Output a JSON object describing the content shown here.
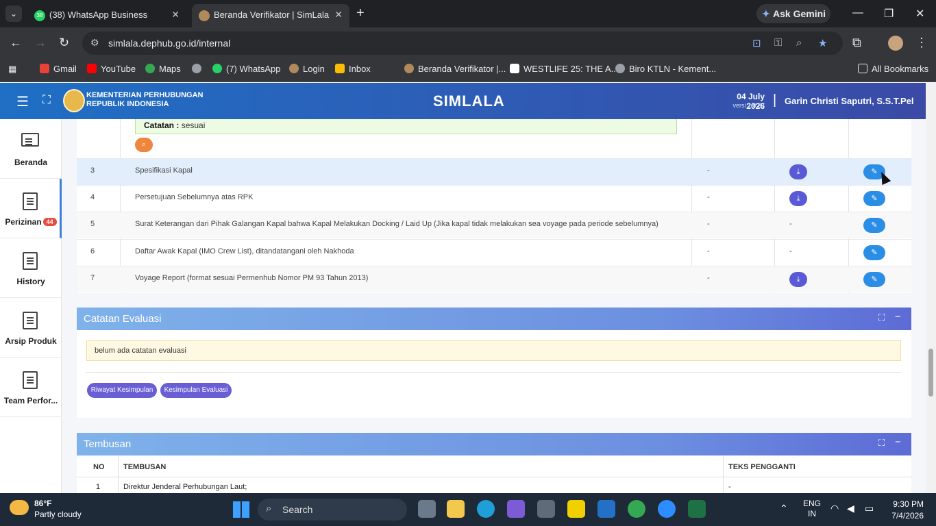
{
  "browser": {
    "tabs": [
      {
        "title": "(38) WhatsApp Business",
        "badge": "38"
      },
      {
        "title": "Beranda Verifikator | SimLala"
      }
    ],
    "ask_gemini": "Ask Gemini",
    "url": "simlala.dephub.go.id/internal",
    "bookmarks": [
      "Gmail",
      "YouTube",
      "Maps",
      "(7) WhatsApp",
      "Login",
      "Inbox",
      "Beranda Verifikator |...",
      "WESTLIFE 25: THE A...",
      "Biro KTLN - Kement..."
    ],
    "all_bookmarks": "All Bookmarks"
  },
  "header": {
    "ministry_line1": "KEMENTERIAN PERHUBUNGAN",
    "ministry_line2": "REPUBLIK INDONESIA",
    "app_title": "SIMLALA",
    "date": "04 July 2026",
    "version": "versi 2.0.27",
    "user": "Garin Christi Saputri, S.S.T.Pel"
  },
  "sidebar": {
    "items": [
      {
        "label": "Beranda"
      },
      {
        "label": "Perizinan",
        "badge": "44"
      },
      {
        "label": "History"
      },
      {
        "label": "Arsip Produk"
      },
      {
        "label": "Team Perfor..."
      }
    ]
  },
  "documents": {
    "catatan_label": "Catatan :",
    "catatan_value": "sesuai",
    "rows": [
      {
        "no": "3",
        "name": "Spesifikasi Kapal",
        "status": "-"
      },
      {
        "no": "4",
        "name": "Persetujuan Sebelumnya atas RPK",
        "status": "-"
      },
      {
        "no": "5",
        "name": "Surat Keterangan dari Pihak Galangan Kapal bahwa Kapal Melakukan Docking / Laid Up (Jika kapal tidak melakukan sea voyage pada periode sebelumnya)",
        "status": "-",
        "download": "-"
      },
      {
        "no": "6",
        "name": "Daftar Awak Kapal (IMO Crew List), ditandatangani oleh Nakhoda",
        "status": "-",
        "download": "-"
      },
      {
        "no": "7",
        "name": "Voyage Report (format sesuai Permenhub Nomor PM 93 Tahun 2013)",
        "status": "-"
      }
    ]
  },
  "evaluasi": {
    "title": "Catatan Evaluasi",
    "note": "belum ada catatan evaluasi",
    "btn_riwayat": "Riwayat Kesimpulan",
    "btn_kesimpulan": "Kesimpulan Evaluasi"
  },
  "tembusan": {
    "title": "Tembusan",
    "col_no": "NO",
    "col_tembusan": "TEMBUSAN",
    "col_teks": "TEKS PENGGANTI",
    "rows": [
      {
        "no": "1",
        "name": "Direktur Jenderal Perhubungan Laut;",
        "teks": "-"
      }
    ]
  },
  "taskbar": {
    "temp": "86°F",
    "condition": "Partly cloudy",
    "search": "Search",
    "lang1": "ENG",
    "lang2": "IN",
    "time": "9:30 PM",
    "date": "7/4/2026"
  },
  "colors": {
    "header_start": "#1f6fc5",
    "header_end": "#3a4aa6",
    "download_btn": "#5a5ad6",
    "edit_btn": "#2b8ee6"
  }
}
